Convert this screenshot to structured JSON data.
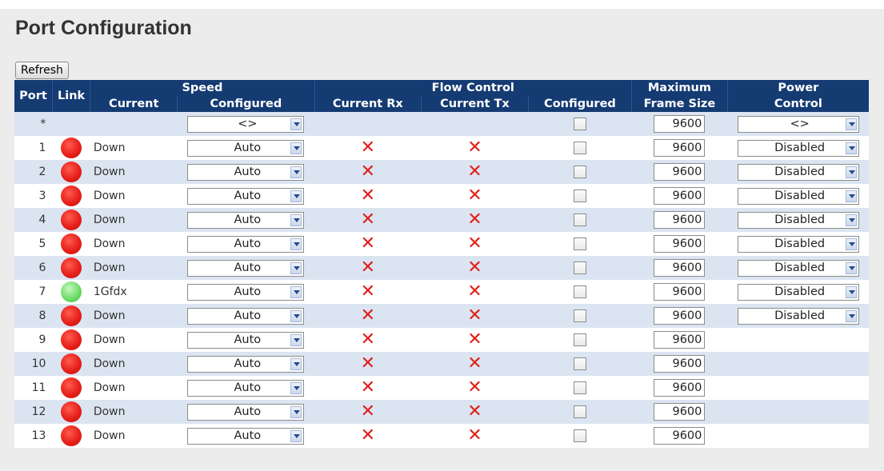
{
  "page_title": "Port Configuration",
  "refresh_label": "Refresh",
  "headers": {
    "port": "Port",
    "link": "Link",
    "speed_group": "Speed",
    "flow_group": "Flow Control",
    "max_frame_line1": "Maximum",
    "max_frame_line2": "Frame Size",
    "power_line1": "Power",
    "power_line2": "Control",
    "current": "Current",
    "configured": "Configured",
    "current_rx": "Current Rx",
    "current_tx": "Current Tx",
    "flow_configured": "Configured"
  },
  "all_row": {
    "port": "*",
    "speed_configured": "<>",
    "max_frame": "9600",
    "power_control": "<>"
  },
  "icons": {
    "flow_off": "red-x-icon",
    "link_down": "red-dot-icon",
    "link_up": "green-dot-icon"
  },
  "rows": [
    {
      "port": "1",
      "link": "down",
      "current": "Down",
      "configured": "Auto",
      "current_rx": "✕",
      "current_tx": "✕",
      "max_frame": "9600",
      "power": "Disabled"
    },
    {
      "port": "2",
      "link": "down",
      "current": "Down",
      "configured": "Auto",
      "current_rx": "✕",
      "current_tx": "✕",
      "max_frame": "9600",
      "power": "Disabled"
    },
    {
      "port": "3",
      "link": "down",
      "current": "Down",
      "configured": "Auto",
      "current_rx": "✕",
      "current_tx": "✕",
      "max_frame": "9600",
      "power": "Disabled"
    },
    {
      "port": "4",
      "link": "down",
      "current": "Down",
      "configured": "Auto",
      "current_rx": "✕",
      "current_tx": "✕",
      "max_frame": "9600",
      "power": "Disabled"
    },
    {
      "port": "5",
      "link": "down",
      "current": "Down",
      "configured": "Auto",
      "current_rx": "✕",
      "current_tx": "✕",
      "max_frame": "9600",
      "power": "Disabled"
    },
    {
      "port": "6",
      "link": "down",
      "current": "Down",
      "configured": "Auto",
      "current_rx": "✕",
      "current_tx": "✕",
      "max_frame": "9600",
      "power": "Disabled"
    },
    {
      "port": "7",
      "link": "up",
      "current": "1Gfdx",
      "configured": "Auto",
      "current_rx": "✕",
      "current_tx": "✕",
      "max_frame": "9600",
      "power": "Disabled"
    },
    {
      "port": "8",
      "link": "down",
      "current": "Down",
      "configured": "Auto",
      "current_rx": "✕",
      "current_tx": "✕",
      "max_frame": "9600",
      "power": "Disabled"
    },
    {
      "port": "9",
      "link": "down",
      "current": "Down",
      "configured": "Auto",
      "current_rx": "✕",
      "current_tx": "✕",
      "max_frame": "9600",
      "power": null
    },
    {
      "port": "10",
      "link": "down",
      "current": "Down",
      "configured": "Auto",
      "current_rx": "✕",
      "current_tx": "✕",
      "max_frame": "9600",
      "power": null
    },
    {
      "port": "11",
      "link": "down",
      "current": "Down",
      "configured": "Auto",
      "current_rx": "✕",
      "current_tx": "✕",
      "max_frame": "9600",
      "power": null
    },
    {
      "port": "12",
      "link": "down",
      "current": "Down",
      "configured": "Auto",
      "current_rx": "✕",
      "current_tx": "✕",
      "max_frame": "9600",
      "power": null
    },
    {
      "port": "13",
      "link": "down",
      "current": "Down",
      "configured": "Auto",
      "current_rx": "✕",
      "current_tx": "✕",
      "max_frame": "9600",
      "power": null
    }
  ],
  "colors": {
    "header_bg": "#153b73",
    "row_alt_bg": "#dbe5f1",
    "link_down": "#e8201a",
    "link_up": "#6fde6a",
    "flow_off": "#e0201a"
  }
}
